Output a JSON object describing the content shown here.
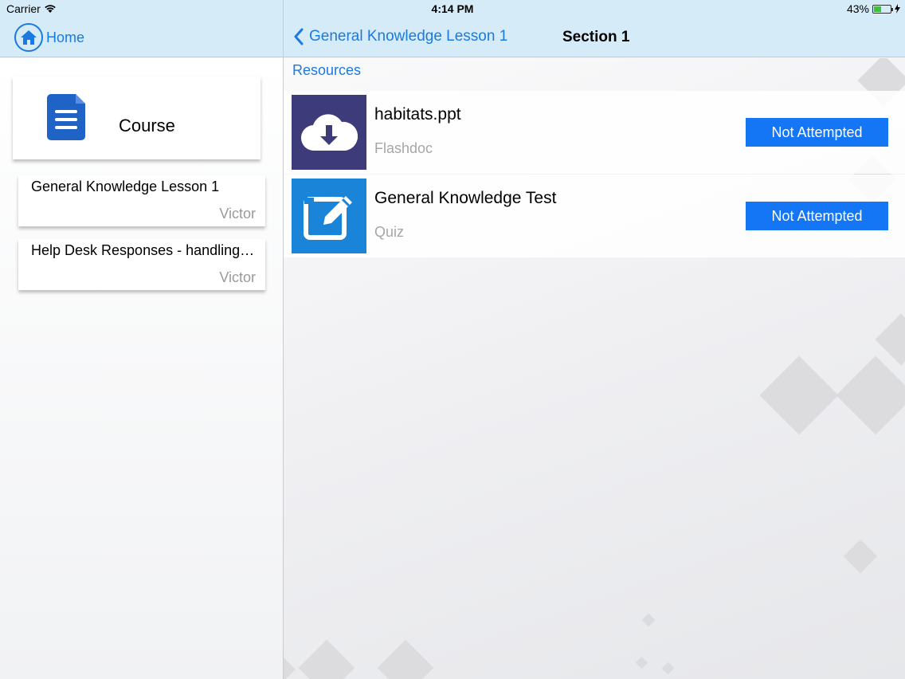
{
  "status_bar": {
    "carrier": "Carrier",
    "time": "4:14 PM",
    "battery_percent": "43%",
    "battery_level": 0.43
  },
  "nav": {
    "home_label": "Home",
    "back_label": "General Knowledge Lesson 1",
    "title": "Section 1"
  },
  "sidebar": {
    "course_label": "Course",
    "lessons": [
      {
        "title": "General Knowledge Lesson 1",
        "author": "Victor"
      },
      {
        "title": "Help Desk Responses - handling difficult customers",
        "author": "Victor"
      }
    ]
  },
  "main": {
    "section_header": "Resources",
    "resources": [
      {
        "name": "habitats.ppt",
        "type": "Flashdoc",
        "status": "Not Attempted",
        "icon": "cloud-download-icon",
        "icon_bg": "#3d3b7a"
      },
      {
        "name": "General Knowledge Test",
        "type": "Quiz",
        "status": "Not Attempted",
        "icon": "edit-icon",
        "icon_bg": "#1a84d8"
      }
    ]
  },
  "colors": {
    "accent": "#1a7ae0",
    "button": "#1476f5",
    "nav_bg": "#d6ebf8"
  }
}
